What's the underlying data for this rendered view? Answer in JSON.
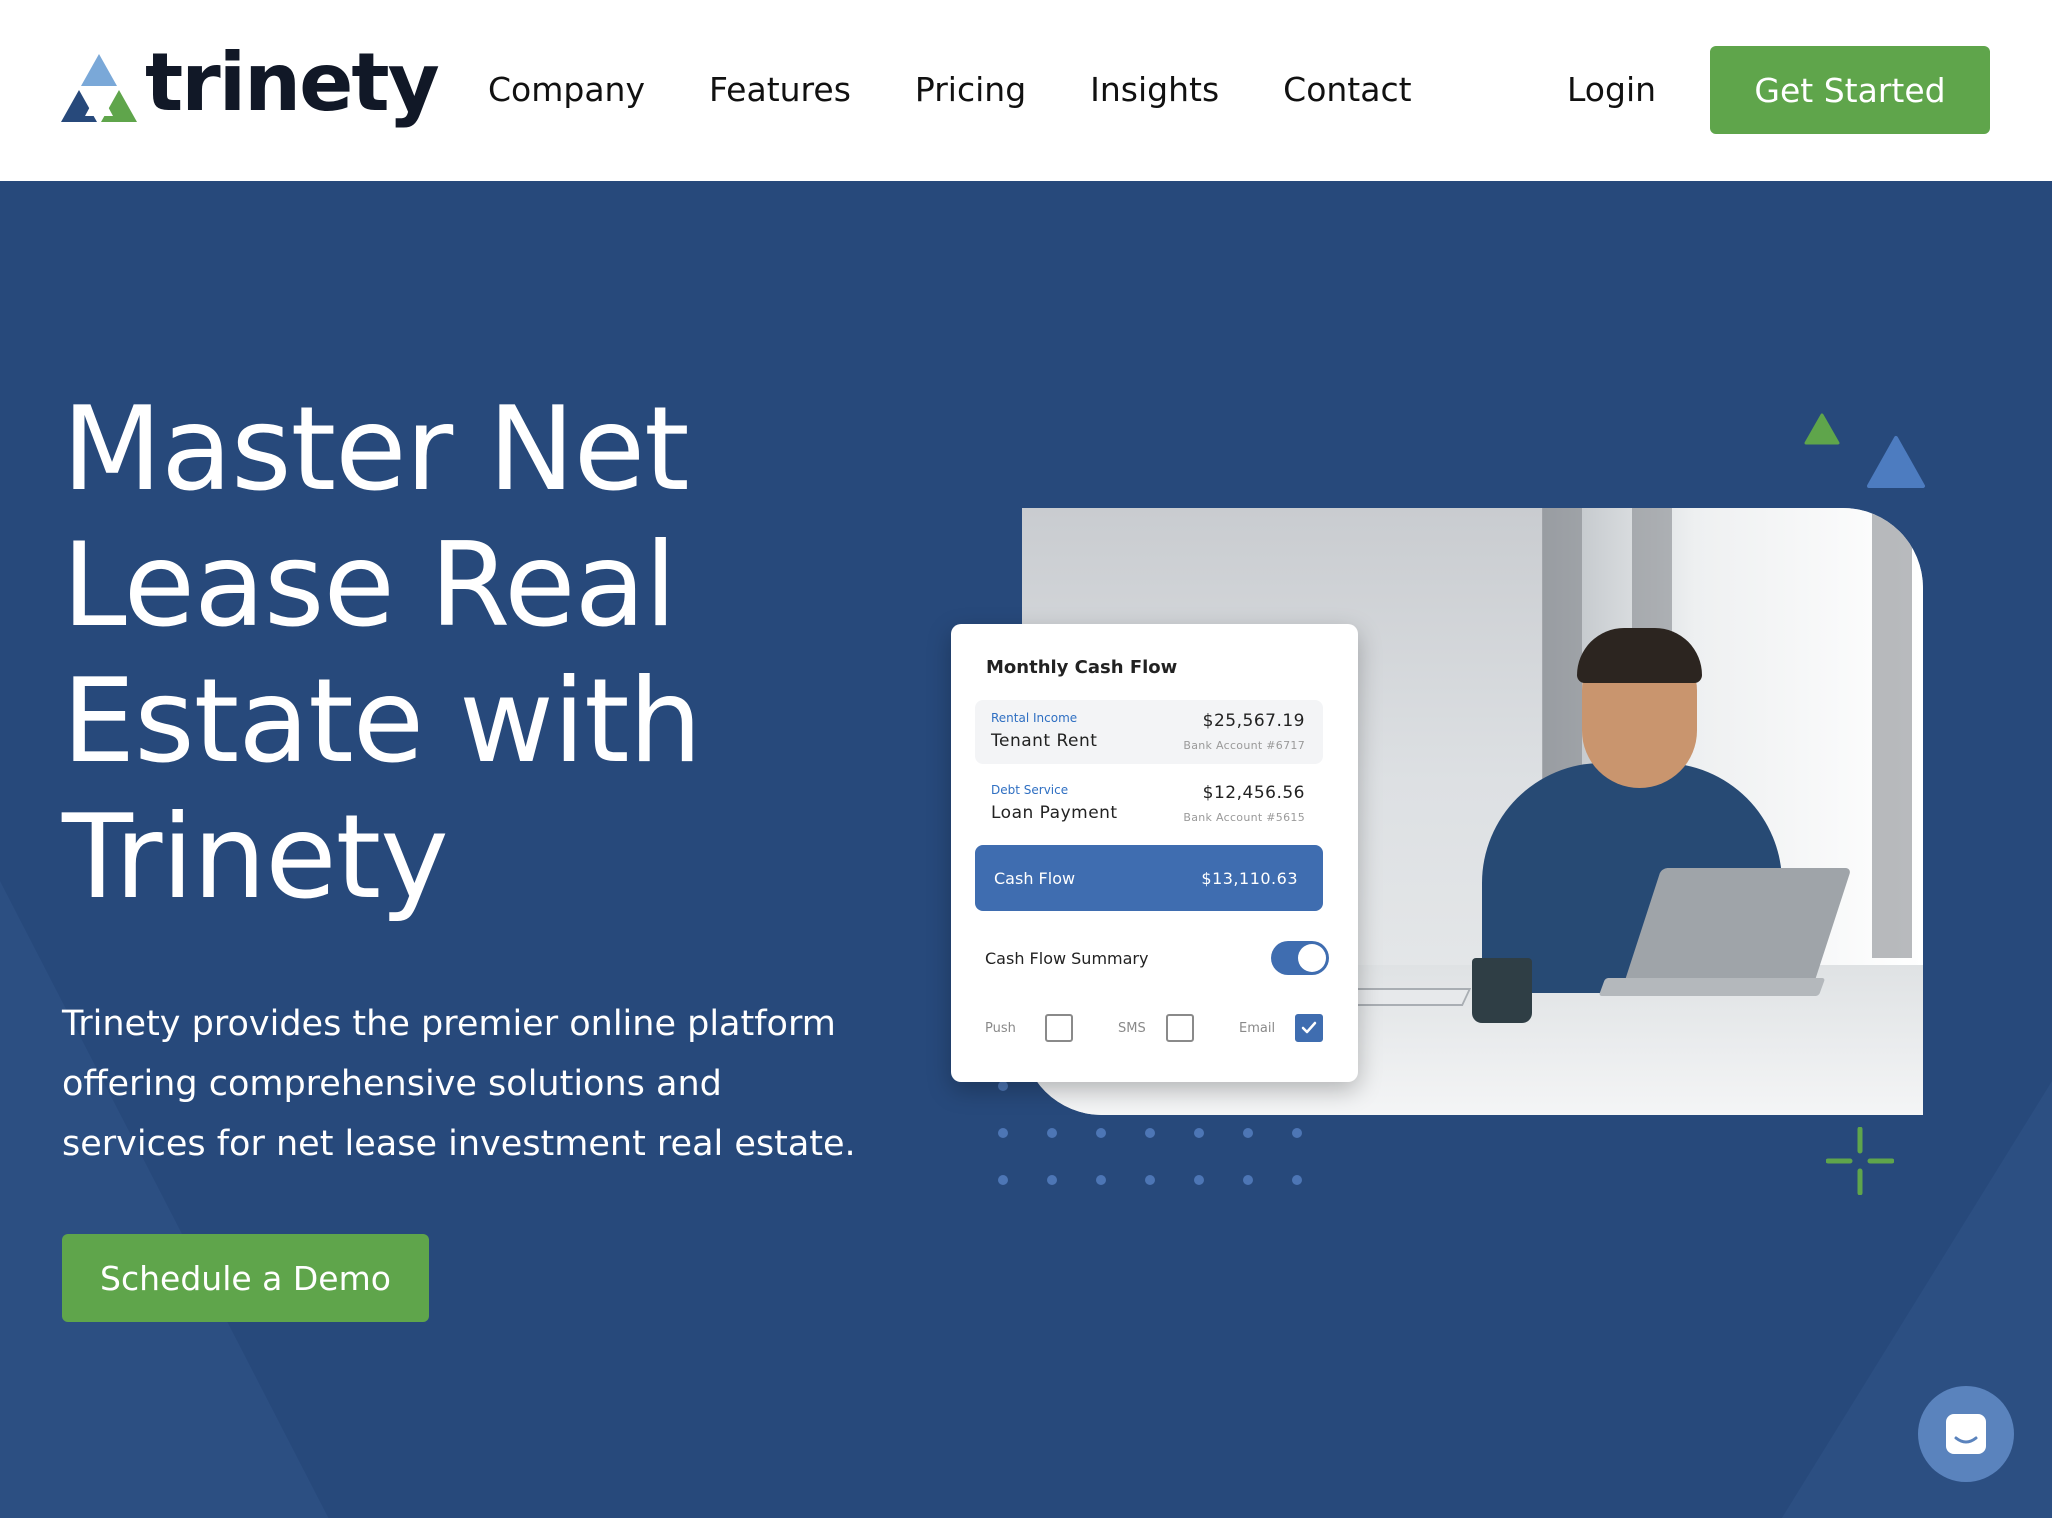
{
  "header": {
    "logo_text": "trinety",
    "nav": [
      "Company",
      "Features",
      "Pricing",
      "Insights",
      "Contact"
    ],
    "login_label": "Login",
    "cta_label": "Get Started"
  },
  "hero": {
    "title_lines": [
      "Master Net",
      "Lease Real",
      "Estate with",
      "Trinety"
    ],
    "subtitle_lines": [
      "Trinety provides the premier online platform",
      "offering comprehensive solutions and",
      "services for net lease investment real estate."
    ],
    "cta_label": "Schedule a Demo"
  },
  "card": {
    "title": "Monthly Cash Flow",
    "rows": [
      {
        "category": "Rental Income",
        "name": "Tenant Rent",
        "amount": "$25,567.19",
        "account": "Bank Account #6717"
      },
      {
        "category": "Debt Service",
        "name": "Loan Payment",
        "amount": "$12,456.56",
        "account": "Bank Account #5615"
      }
    ],
    "cashflow_label": "Cash Flow",
    "cashflow_amount": "$13,110.63",
    "summary_label": "Cash Flow Summary",
    "summary_enabled": true,
    "options": [
      {
        "label": "Push",
        "checked": false
      },
      {
        "label": "SMS",
        "checked": false
      },
      {
        "label": "Email",
        "checked": true
      }
    ]
  },
  "colors": {
    "brand_green": "#5fa54b",
    "hero_blue": "#27497b",
    "accent_blue": "#3f6db0",
    "logo_light_blue": "#7aa8d8",
    "logo_dark_blue": "#27497b"
  },
  "icons": {
    "logo": "triangle-logo-icon",
    "chat": "chat-bubble-icon",
    "checkmark": "checkmark-icon"
  }
}
